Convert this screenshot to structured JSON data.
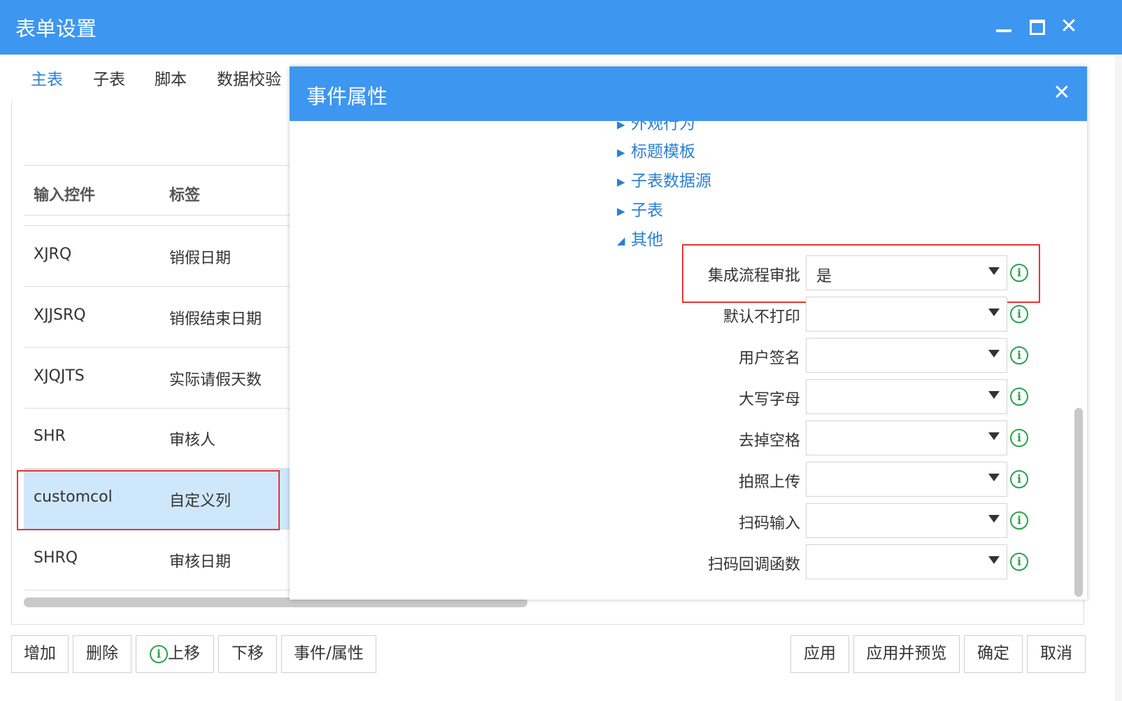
{
  "window": {
    "title": "表单设置"
  },
  "tabs": [
    {
      "label": "主表"
    },
    {
      "label": "子表"
    },
    {
      "label": "脚本"
    },
    {
      "label": "数据校验"
    }
  ],
  "table": {
    "headers": {
      "control": "输入控件",
      "label": "标签"
    },
    "rows": [
      {
        "control": "XJRQ",
        "label": "销假日期"
      },
      {
        "control": "XJJSRQ",
        "label": "销假结束日期"
      },
      {
        "control": "XJQJTS",
        "label": "实际请假天数"
      },
      {
        "control": "SHR",
        "label": "审核人"
      },
      {
        "control": "customcol",
        "label": "自定义列"
      },
      {
        "control": "SHRQ",
        "label": "审核日期"
      }
    ]
  },
  "buttons": {
    "add": "增加",
    "delete": "删除",
    "move_up": "上移",
    "move_down": "下移",
    "events": "事件/属性",
    "apply": "应用",
    "apply_preview": "应用并预览",
    "ok": "确定",
    "cancel": "取消"
  },
  "modal": {
    "title": "事件属性",
    "tree": [
      {
        "label": "外观行为",
        "expanded": false
      },
      {
        "label": "标题模板",
        "expanded": false
      },
      {
        "label": "子表数据源",
        "expanded": false
      },
      {
        "label": "子表",
        "expanded": false
      },
      {
        "label": "其他",
        "expanded": true
      }
    ],
    "properties": [
      {
        "label": "集成流程审批",
        "value": "是"
      },
      {
        "label": "默认不打印",
        "value": ""
      },
      {
        "label": "用户签名",
        "value": ""
      },
      {
        "label": "大写字母",
        "value": ""
      },
      {
        "label": "去掉空格",
        "value": ""
      },
      {
        "label": "拍照上传",
        "value": ""
      },
      {
        "label": "扫码输入",
        "value": ""
      },
      {
        "label": "扫码回调函数",
        "value": ""
      }
    ]
  },
  "icons": {
    "info": "info-icon",
    "collapsed": "triangle-right-icon",
    "expanded": "triangle-down-icon",
    "dropdown": "caret-down-icon"
  },
  "colors": {
    "title_bar": "#3d96f0",
    "accent": "#2a7fd4",
    "selected_row": "#cfe7fb",
    "highlight": "#e53535",
    "info_green": "#27a34a"
  }
}
